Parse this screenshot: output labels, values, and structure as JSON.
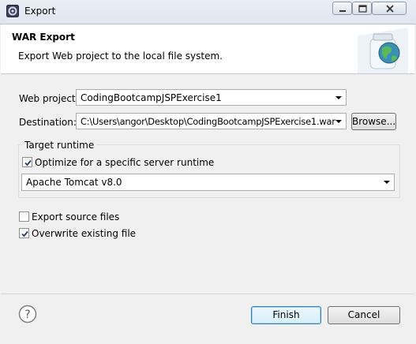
{
  "window": {
    "title": "Export"
  },
  "header": {
    "title": "WAR Export",
    "description": "Export Web project to the local file system.",
    "graphic_icon": "war-export-globe-jar-icon"
  },
  "form": {
    "web_project_label": "Web project:",
    "web_project_value": "CodingBootcampJSPExercise1",
    "destination_label": "Destination:",
    "destination_value": "C:\\Users\\angor\\Desktop\\CodingBootcampJSPExercise1.war",
    "browse_label": "Browse..."
  },
  "target_runtime": {
    "group_title": "Target runtime",
    "optimize_label": "Optimize for a specific server runtime",
    "optimize_checked": true,
    "runtime_value": "Apache Tomcat v8.0"
  },
  "options": {
    "export_source_label": "Export source files",
    "export_source_checked": false,
    "overwrite_label": "Overwrite existing file",
    "overwrite_checked": true
  },
  "footer": {
    "finish_label": "Finish",
    "cancel_label": "Cancel",
    "help_icon": "help-icon"
  }
}
